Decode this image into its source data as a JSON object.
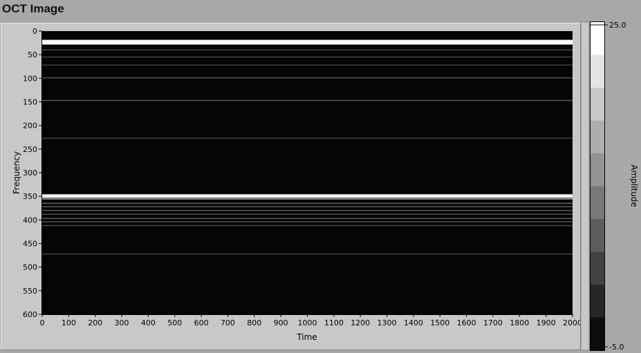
{
  "window": {
    "title": "OCT Image"
  },
  "chart_data": {
    "type": "heatmap",
    "xlabel": "Time",
    "ylabel": "Frequency",
    "xlim": [
      0,
      2000
    ],
    "ylim": [
      0,
      600
    ],
    "y_inverted": true,
    "x_ticks": [
      0,
      100,
      200,
      300,
      400,
      500,
      600,
      700,
      800,
      900,
      1000,
      1100,
      1200,
      1300,
      1400,
      1500,
      1600,
      1700,
      1800,
      1900,
      2000
    ],
    "y_ticks": [
      0,
      50,
      100,
      150,
      200,
      250,
      300,
      350,
      400,
      450,
      500,
      550,
      600
    ],
    "colorbar": {
      "label": "Amplitude",
      "min": -5.0,
      "max": 25.0,
      "min_label": "-5.0",
      "max_label": "25.0",
      "levels": 10,
      "colormap": "grayscale"
    },
    "bands": [
      {
        "frequency": 21,
        "amplitude": 24
      },
      {
        "frequency": 26,
        "amplitude": 25
      },
      {
        "frequency": 40,
        "amplitude": 3
      },
      {
        "frequency": 55,
        "amplitude": 2
      },
      {
        "frequency": 72,
        "amplitude": 1.5
      },
      {
        "frequency": 99,
        "amplitude": 4
      },
      {
        "frequency": 147,
        "amplitude": 5
      },
      {
        "frequency": 227,
        "amplitude": 2
      },
      {
        "frequency": 347,
        "amplitude": 16
      },
      {
        "frequency": 350,
        "amplitude": 25
      },
      {
        "frequency": 355,
        "amplitude": 12
      },
      {
        "frequency": 365,
        "amplitude": 6
      },
      {
        "frequency": 372,
        "amplitude": 5
      },
      {
        "frequency": 380,
        "amplitude": 5
      },
      {
        "frequency": 388,
        "amplitude": 4
      },
      {
        "frequency": 397,
        "amplitude": 5
      },
      {
        "frequency": 404,
        "amplitude": 4
      },
      {
        "frequency": 412,
        "amplitude": 3
      },
      {
        "frequency": 472,
        "amplitude": 2
      }
    ]
  }
}
